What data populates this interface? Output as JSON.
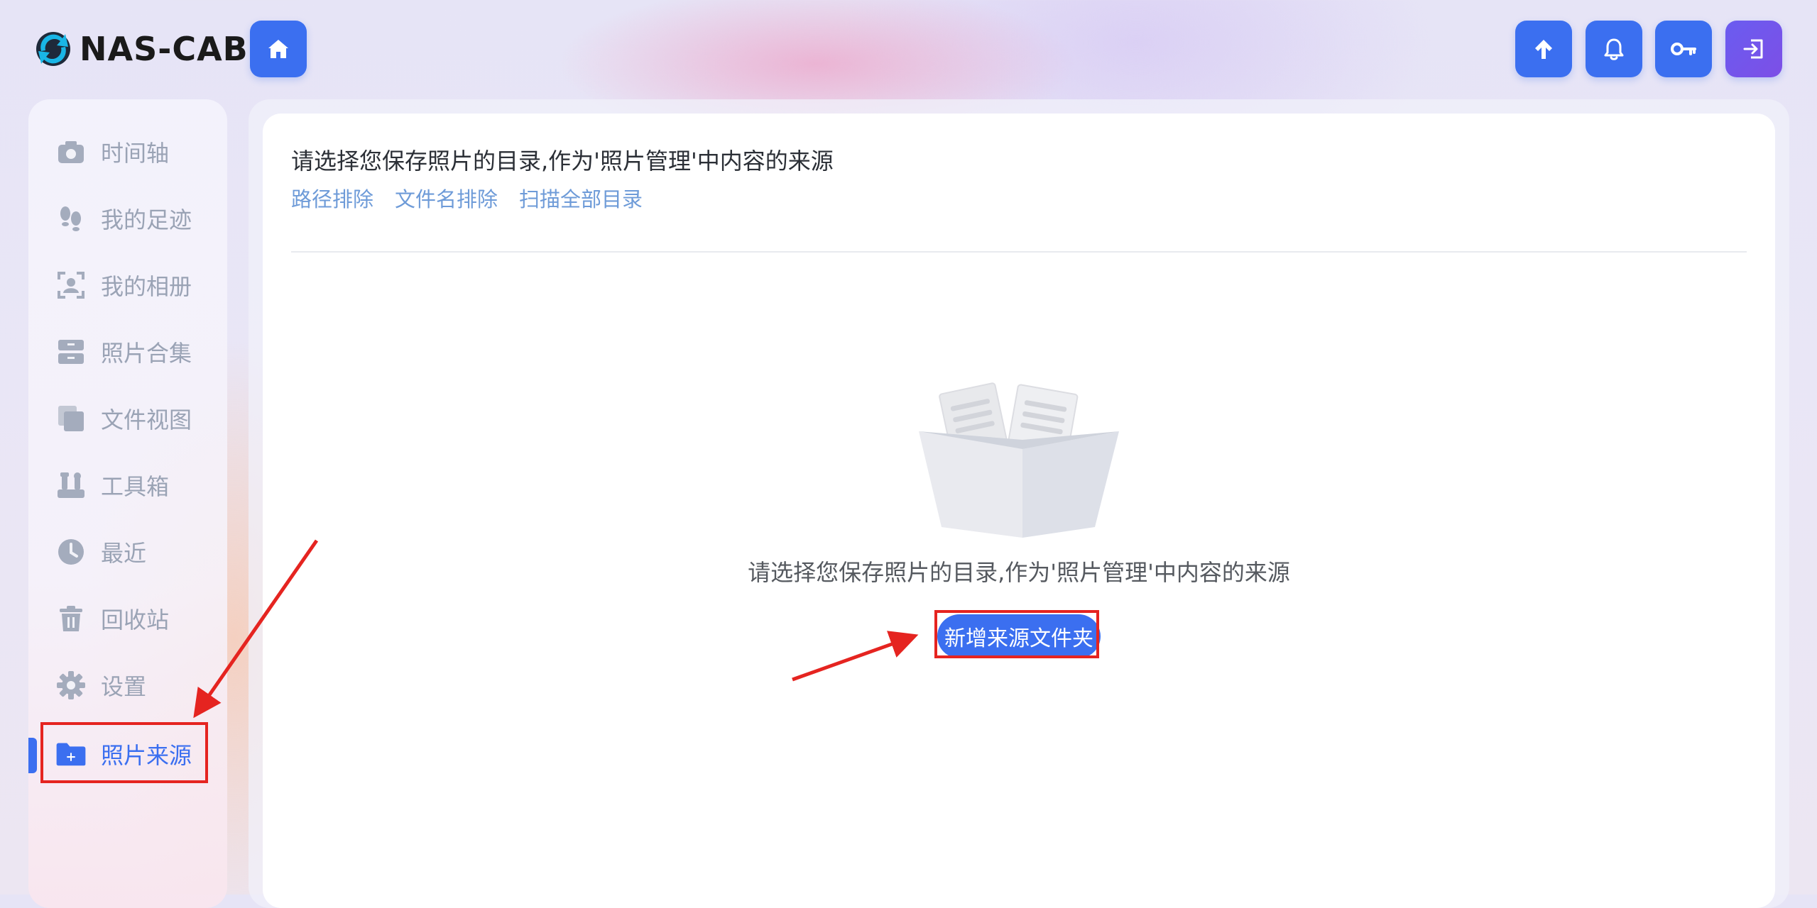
{
  "app": {
    "logo_text": "NAS-CAB"
  },
  "header": {
    "buttons": [
      {
        "name": "home",
        "icon": "home-icon"
      },
      {
        "name": "upload",
        "icon": "arrow-up-icon"
      },
      {
        "name": "notifications",
        "icon": "bell-icon"
      },
      {
        "name": "key",
        "icon": "key-icon"
      },
      {
        "name": "logout",
        "icon": "logout-icon"
      }
    ]
  },
  "sidebar": {
    "items": [
      {
        "label": "时间轴",
        "icon": "camera-icon"
      },
      {
        "label": "我的足迹",
        "icon": "footprints-icon"
      },
      {
        "label": "我的相册",
        "icon": "portrait-icon"
      },
      {
        "label": "照片合集",
        "icon": "archive-icon"
      },
      {
        "label": "文件视图",
        "icon": "copy-icon"
      },
      {
        "label": "工具箱",
        "icon": "toolbox-icon"
      },
      {
        "label": "最近",
        "icon": "clock-icon"
      },
      {
        "label": "回收站",
        "icon": "trash-icon"
      },
      {
        "label": "设置",
        "icon": "gear-icon"
      },
      {
        "label": "照片来源",
        "icon": "folder-plus-icon",
        "active": true
      }
    ]
  },
  "main": {
    "title": "请选择您保存照片的目录,作为'照片管理'中内容的来源",
    "links": [
      "路径排除",
      "文件名排除",
      "扫描全部目录"
    ],
    "empty_text": "请选择您保存照片的目录,作为'照片管理'中内容的来源",
    "add_button_label": "新增来源文件夹"
  },
  "colors": {
    "accent": "#3b6ff0",
    "link": "#6e9bd8",
    "annotation": "#e52420",
    "sidebar_text": "#9aa3b5"
  }
}
